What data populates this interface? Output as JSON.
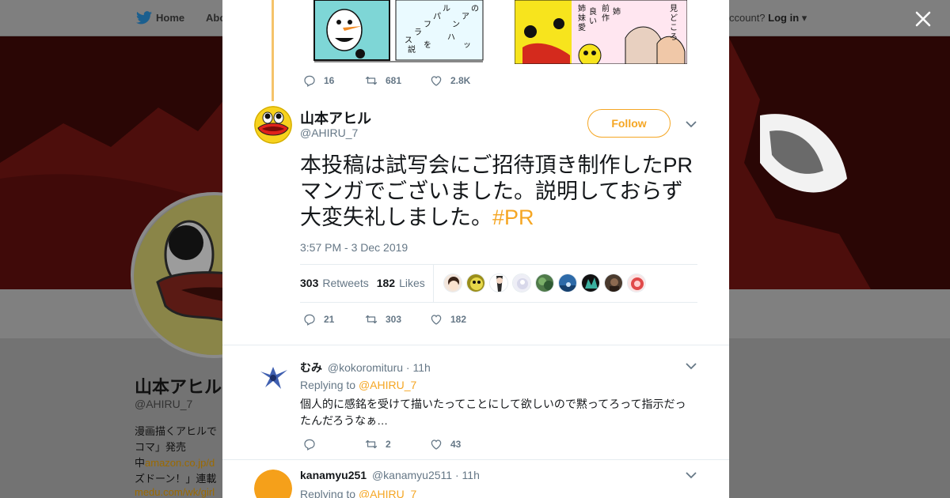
{
  "background": {
    "nav": {
      "home": "Home",
      "about": "Abo",
      "account_q": "ccount?",
      "login": "Log in"
    },
    "profile": {
      "name": "山本アヒル",
      "handle": "@AHIRU_7",
      "bio_lines": [
        {
          "text": "漫画描くアヒルで",
          "link": ""
        },
        {
          "text": "コマ」発売",
          "link": ""
        },
        {
          "text": "中",
          "link": "amazon.co.jp/d"
        },
        {
          "text": "ズドーン！」連載",
          "link": ""
        },
        {
          "text": "",
          "link": "medu.com/wk/girl"
        }
      ]
    }
  },
  "modal": {
    "prev_tweet": {
      "replies": "16",
      "retweets": "681",
      "likes": "2.8K"
    },
    "tweet": {
      "author_name": "山本アヒル",
      "author_handle": "@AHIRU_7",
      "follow_label": "Follow",
      "text": "本投稿は試写会にご招待頂き制作したPRマンガでございました。説明しておらず大変失礼しました。",
      "hashtag": "#PR",
      "timestamp": "3:57 PM - 3 Dec 2019",
      "retweet_count": "303",
      "retweet_label": "Retweets",
      "like_count": "182",
      "like_label": "Likes",
      "actions": {
        "replies": "21",
        "retweets": "303",
        "likes": "182"
      }
    },
    "replies": [
      {
        "name": "むみ",
        "handle": "@kokoromituru",
        "time": "11h",
        "replying_label": "Replying to",
        "replying_to": "@AHIRU_7",
        "text": "個人的に感銘を受けて描いたってことにして欲しいので黙ってろって指示だったんだろうなぁ…",
        "actions": {
          "replies": "",
          "retweets": "2",
          "likes": "43"
        }
      },
      {
        "name": "kanamyu251",
        "handle": "@kanamyu2511",
        "time": "11h",
        "replying_label": "Replying to",
        "replying_to": "@AHIRU_7"
      }
    ]
  },
  "colors": {
    "accent": "#f5a623",
    "muted": "#657786",
    "text": "#14171a"
  }
}
